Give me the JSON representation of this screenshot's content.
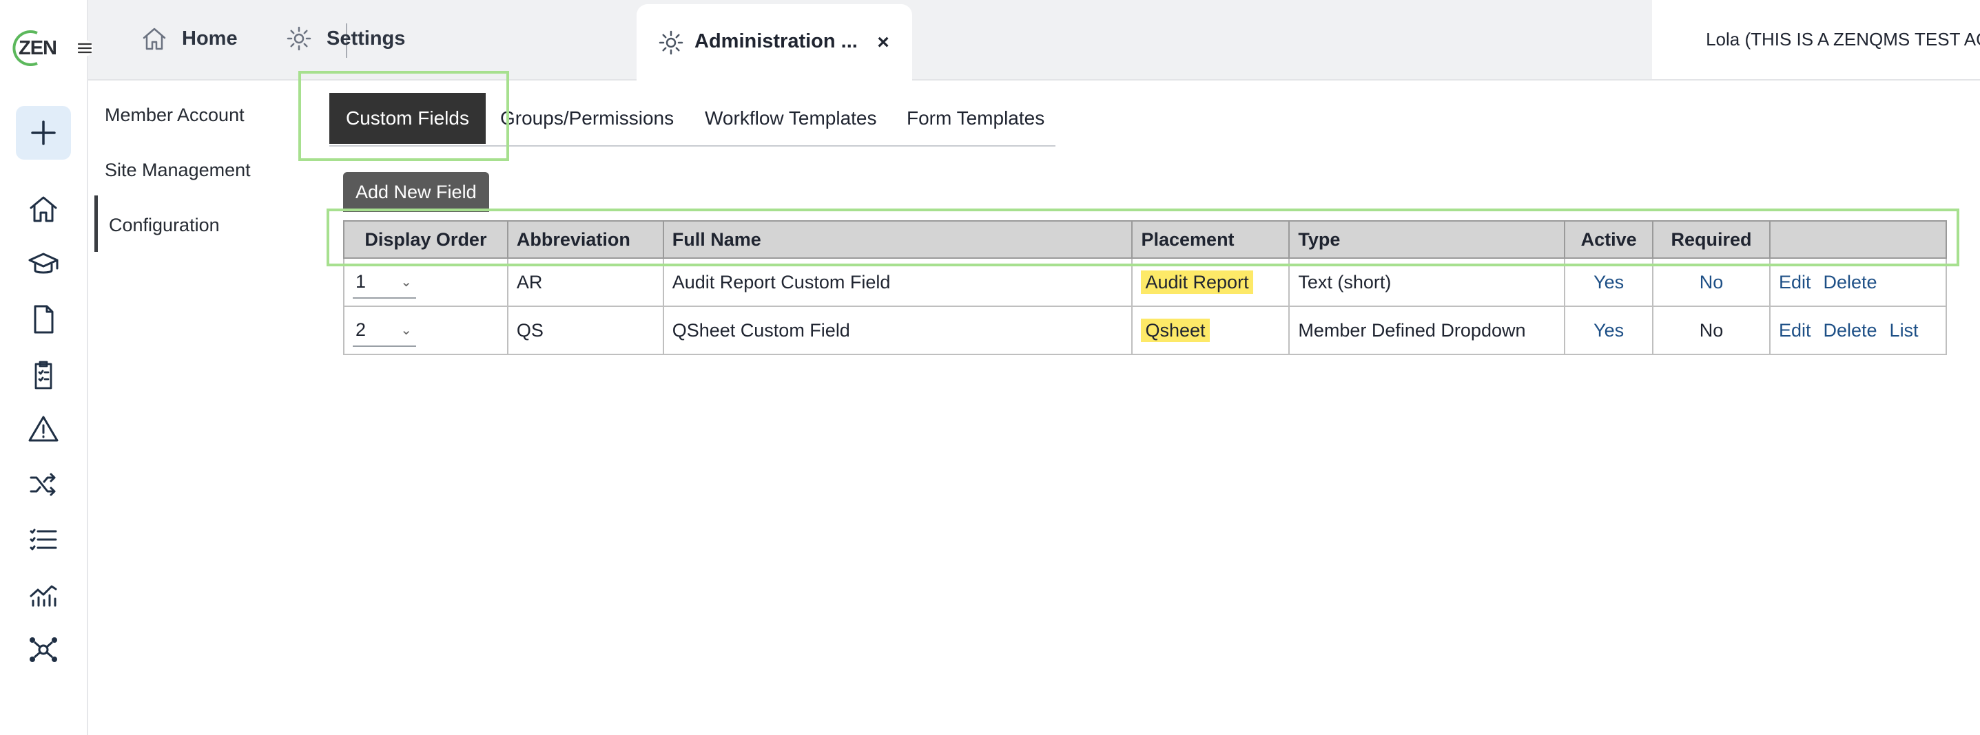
{
  "app": {
    "logo_text": "ZEN",
    "brand_green": "#5cb85c",
    "accent": "#a7e08f"
  },
  "rail": {
    "menu_icon": "hamburger-icon",
    "add_icon": "plus-icon",
    "icons": [
      "home-icon",
      "graduation-cap-icon",
      "document-icon",
      "clipboard-checklist-icon",
      "warning-icon",
      "shuffle-icon",
      "checklist-icon",
      "analytics-icon",
      "network-icon"
    ]
  },
  "header": {
    "tabs": [
      {
        "label": "Home",
        "icon": "home-icon"
      },
      {
        "label": "Settings",
        "icon": "gear-icon"
      }
    ],
    "active_tab": {
      "label": "Administration ...",
      "icon": "gear-icon",
      "close": "×"
    },
    "user": "Lola (THIS IS A ZENQMS TEST ACCOUNT)"
  },
  "subnav": {
    "items": [
      "Member Account",
      "Site Management",
      "Configuration"
    ],
    "selected": "Configuration"
  },
  "inner_tabs": {
    "items": [
      "Custom Fields",
      "Groups/Permissions",
      "Workflow Templates",
      "Form Templates"
    ],
    "selected": "Custom Fields"
  },
  "toolbar": {
    "add_label": "Add New Field"
  },
  "table": {
    "columns": [
      "Display Order",
      "Abbreviation",
      "Full Name",
      "Placement",
      "Type",
      "Active",
      "Required",
      ""
    ],
    "rows": [
      {
        "order": "1",
        "abbr": "AR",
        "full_name": "Audit Report Custom Field",
        "placement": "Audit Report",
        "type": "Text (short)",
        "active": "Yes",
        "required": "No",
        "actions": [
          "Edit",
          "Delete"
        ]
      },
      {
        "order": "2",
        "abbr": "QS",
        "full_name": "QSheet Custom Field",
        "placement": "Qsheet",
        "type": "Member Defined Dropdown",
        "active": "Yes",
        "required": "No",
        "actions": [
          "Edit",
          "Delete",
          "List"
        ]
      }
    ]
  },
  "colors": {
    "highlight": "#fde968",
    "link": "#1d4f86",
    "header_bg": "#d4d4d4",
    "active_tab_bg": "#333333"
  }
}
